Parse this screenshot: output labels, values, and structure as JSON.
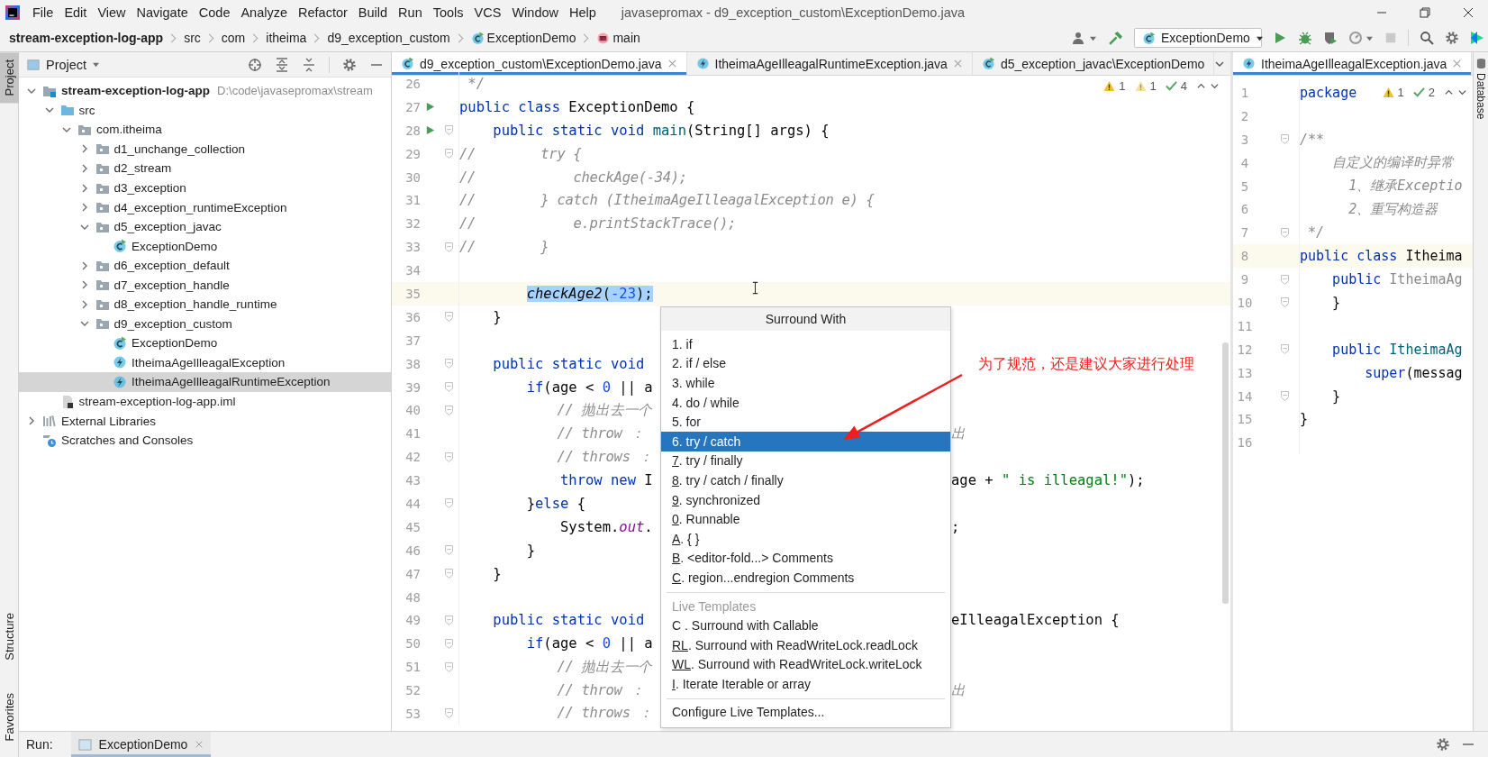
{
  "title_bar": {
    "menu": [
      "File",
      "Edit",
      "View",
      "Navigate",
      "Code",
      "Analyze",
      "Refactor",
      "Build",
      "Run",
      "Tools",
      "VCS",
      "Window",
      "Help"
    ],
    "title": "javasepromax - d9_exception_custom\\ExceptionDemo.java"
  },
  "breadcrumbs": [
    {
      "text": "stream-exception-log-app",
      "kind": "project"
    },
    {
      "text": "src",
      "kind": "folder"
    },
    {
      "text": "com",
      "kind": "folder"
    },
    {
      "text": "itheima",
      "kind": "folder"
    },
    {
      "text": "d9_exception_custom",
      "kind": "folder"
    },
    {
      "text": "ExceptionDemo",
      "kind": "class"
    },
    {
      "text": "main",
      "kind": "method"
    }
  ],
  "run_configuration": "ExceptionDemo",
  "left_strip": {
    "top": [
      {
        "label": "Project",
        "selected": true
      }
    ],
    "bottom": [
      {
        "label": "Structure",
        "selected": false
      },
      {
        "label": "Favorites",
        "selected": false
      }
    ]
  },
  "project_panel": {
    "title": "Project",
    "tree": [
      {
        "name": "stream-exception-log-app",
        "kind": "module",
        "path": "D:\\code\\javasepromax\\stream",
        "expanded": true,
        "selected": false,
        "children": [
          {
            "name": "src",
            "kind": "source-folder",
            "expanded": true,
            "selected": false,
            "children": [
              {
                "name": "com.itheima",
                "kind": "package",
                "expanded": true,
                "selected": false,
                "children": [
                  {
                    "name": "d1_unchange_collection",
                    "kind": "package",
                    "expanded": false,
                    "selected": false
                  },
                  {
                    "name": "d2_stream",
                    "kind": "package",
                    "expanded": false,
                    "selected": false
                  },
                  {
                    "name": "d3_exception",
                    "kind": "package",
                    "expanded": false,
                    "selected": false
                  },
                  {
                    "name": "d4_exception_runtimeException",
                    "kind": "package",
                    "expanded": false,
                    "selected": false
                  },
                  {
                    "name": "d5_exception_javac",
                    "kind": "package",
                    "expanded": true,
                    "selected": false,
                    "children": [
                      {
                        "name": "ExceptionDemo",
                        "kind": "class",
                        "selected": false
                      }
                    ]
                  },
                  {
                    "name": "d6_exception_default",
                    "kind": "package",
                    "expanded": false,
                    "selected": false
                  },
                  {
                    "name": "d7_exception_handle",
                    "kind": "package",
                    "expanded": false,
                    "selected": false
                  },
                  {
                    "name": "d8_exception_handle_runtime",
                    "kind": "package",
                    "expanded": false,
                    "selected": false
                  },
                  {
                    "name": "d9_exception_custom",
                    "kind": "package",
                    "expanded": true,
                    "selected": false,
                    "children": [
                      {
                        "name": "ExceptionDemo",
                        "kind": "class",
                        "selected": false
                      },
                      {
                        "name": "ItheimaAgeIlleagalException",
                        "kind": "exception",
                        "selected": false
                      },
                      {
                        "name": "ItheimaAgeIlleagalRuntimeException",
                        "kind": "exception",
                        "selected": true
                      }
                    ]
                  }
                ]
              }
            ]
          },
          {
            "name": "stream-exception-log-app.iml",
            "kind": "iml",
            "selected": false
          }
        ]
      },
      {
        "name": "External Libraries",
        "kind": "libraries",
        "expanded": false,
        "selected": false
      },
      {
        "name": "Scratches and Consoles",
        "kind": "scratches",
        "selected": false
      }
    ]
  },
  "editors": [
    {
      "tabs": [
        {
          "title": "d9_exception_custom\\ExceptionDemo.java",
          "kind": "class",
          "selected": true,
          "closable": true
        },
        {
          "title": "ItheimaAgeIlleagalRuntimeException.java",
          "kind": "exception",
          "selected": false,
          "closable": true
        },
        {
          "title": "d5_exception_javac\\ExceptionDemo",
          "kind": "class",
          "selected": false,
          "closable": false
        }
      ],
      "inspections": [
        {
          "kind": "warning",
          "count": "1"
        },
        {
          "kind": "weak-warning",
          "count": "1"
        },
        {
          "kind": "ok",
          "count": "4"
        }
      ],
      "lines": [
        {
          "number": "26",
          "current": false,
          "code": [
            {
              "text": " */",
              "kind": "doc"
            }
          ]
        },
        {
          "number": "27",
          "current": false,
          "run": true,
          "code": [
            {
              "text": "public class ",
              "kind": "keyword"
            },
            {
              "text": "ExceptionDemo {",
              "kind": "plain"
            }
          ]
        },
        {
          "number": "28",
          "current": false,
          "run": true,
          "fold": true,
          "code": [
            {
              "text": "    public static void ",
              "kind": "keyword"
            },
            {
              "text": "main",
              "kind": "method-decl"
            },
            {
              "text": "(String[] args) {",
              "kind": "plain"
            }
          ]
        },
        {
          "number": "29",
          "current": false,
          "fold": true,
          "code": [
            {
              "text": "//        try {",
              "kind": "comment"
            }
          ]
        },
        {
          "number": "30",
          "current": false,
          "code": [
            {
              "text": "//            checkAge(-34);",
              "kind": "comment"
            }
          ]
        },
        {
          "number": "31",
          "current": false,
          "code": [
            {
              "text": "//        } catch (ItheimaAgeIlleagalException e) {",
              "kind": "comment"
            }
          ]
        },
        {
          "number": "32",
          "current": false,
          "code": [
            {
              "text": "//            e.printStackTrace();",
              "kind": "comment"
            }
          ]
        },
        {
          "number": "33",
          "current": false,
          "fold": true,
          "code": [
            {
              "text": "//        }",
              "kind": "comment"
            }
          ]
        },
        {
          "number": "34",
          "current": false
        },
        {
          "number": "35",
          "current": true,
          "code": [
            {
              "text": "        checkAge2",
              "kind": "static-call",
              "selected": true
            },
            {
              "text": "(",
              "kind": "plain",
              "selected": true
            },
            {
              "text": "-23",
              "kind": "number",
              "selected": true
            },
            {
              "text": ");",
              "kind": "plain",
              "selected": true
            }
          ]
        },
        {
          "number": "36",
          "current": false,
          "fold": true,
          "code": [
            {
              "text": "    }",
              "kind": "plain"
            }
          ]
        },
        {
          "number": "37",
          "current": false
        },
        {
          "number": "38",
          "current": false,
          "fold": true,
          "code": [
            {
              "text": "    public static void ",
              "kind": "keyword"
            }
          ]
        },
        {
          "number": "39",
          "current": false,
          "fold": true,
          "code": [
            {
              "text": "        if",
              "kind": "keyword"
            },
            {
              "text": "(age < ",
              "kind": "plain"
            },
            {
              "text": "0",
              "kind": "number"
            },
            {
              "text": " || a",
              "kind": "plain"
            }
          ]
        },
        {
          "number": "40",
          "current": false,
          "fold": true,
          "code": [
            {
              "text": "            // 抛出去一个",
              "kind": "comment"
            }
          ]
        },
        {
          "number": "41",
          "current": false,
          "code": [
            {
              "text": "            // throw ：",
              "kind": "comment"
            }
          ],
          "right": [
            {
              "text": "出",
              "kind": "comment"
            }
          ]
        },
        {
          "number": "42",
          "current": false,
          "fold": true,
          "code": [
            {
              "text": "            // throws ：",
              "kind": "comment"
            }
          ]
        },
        {
          "number": "43",
          "current": false,
          "code": [
            {
              "text": "            throw new ",
              "kind": "keyword"
            },
            {
              "text": "I",
              "kind": "plain"
            }
          ],
          "right": [
            {
              "text": "age + ",
              "kind": "plain"
            },
            {
              "text": "\" is illeagal!\"",
              "kind": "string"
            },
            {
              "text": ");",
              "kind": "plain"
            }
          ]
        },
        {
          "number": "44",
          "current": false,
          "fold": true,
          "code": [
            {
              "text": "        }",
              "kind": "plain"
            },
            {
              "text": "else",
              "kind": "keyword"
            },
            {
              "text": " {",
              "kind": "plain"
            }
          ]
        },
        {
          "number": "45",
          "current": false,
          "code": [
            {
              "text": "            System.",
              "kind": "plain"
            },
            {
              "text": "out",
              "kind": "static-field"
            },
            {
              "text": ".",
              "kind": "plain"
            }
          ],
          "right": [
            {
              "text": ";",
              "kind": "plain"
            }
          ]
        },
        {
          "number": "46",
          "current": false,
          "fold": true,
          "code": [
            {
              "text": "        }",
              "kind": "plain"
            }
          ]
        },
        {
          "number": "47",
          "current": false,
          "fold": true,
          "code": [
            {
              "text": "    }",
              "kind": "plain"
            }
          ]
        },
        {
          "number": "48",
          "current": false
        },
        {
          "number": "49",
          "current": false,
          "fold": true,
          "code": [
            {
              "text": "    public static void ",
              "kind": "keyword"
            }
          ],
          "right": [
            {
              "text": "eIlleagalException {",
              "kind": "plain"
            }
          ]
        },
        {
          "number": "50",
          "current": false,
          "fold": true,
          "code": [
            {
              "text": "        if",
              "kind": "keyword"
            },
            {
              "text": "(age < ",
              "kind": "plain"
            },
            {
              "text": "0",
              "kind": "number"
            },
            {
              "text": " || a",
              "kind": "plain"
            }
          ]
        },
        {
          "number": "51",
          "current": false,
          "fold": true,
          "code": [
            {
              "text": "            // 抛出去一个",
              "kind": "comment"
            }
          ]
        },
        {
          "number": "52",
          "current": false,
          "code": [
            {
              "text": "            // throw ：",
              "kind": "comment"
            }
          ],
          "right": [
            {
              "text": "出",
              "kind": "comment"
            }
          ]
        },
        {
          "number": "53",
          "current": false,
          "fold": true,
          "code": [
            {
              "text": "            // throws ：",
              "kind": "comment"
            }
          ]
        }
      ]
    },
    {
      "tabs": [
        {
          "title": "ItheimaAgeIlleagalException.java",
          "kind": "exception",
          "selected": true,
          "closable": true
        }
      ],
      "inspections": [
        {
          "kind": "warning",
          "count": "1"
        },
        {
          "kind": "ok",
          "count": "2"
        }
      ],
      "lines": [
        {
          "number": "1",
          "current": false,
          "code": [
            {
              "text": "package",
              "kind": "keyword"
            }
          ]
        },
        {
          "number": "2",
          "current": false
        },
        {
          "number": "3",
          "current": false,
          "fold": true,
          "code": [
            {
              "text": "/**",
              "kind": "doc"
            }
          ]
        },
        {
          "number": "4",
          "current": false,
          "code": [
            {
              "text": "    自定义的编译时异常",
              "kind": "doc"
            }
          ]
        },
        {
          "number": "5",
          "current": false,
          "code": [
            {
              "text": "      1、继承Exceptio",
              "kind": "doc"
            }
          ]
        },
        {
          "number": "6",
          "current": false,
          "code": [
            {
              "text": "      2、重写构造器",
              "kind": "doc"
            }
          ]
        },
        {
          "number": "7",
          "current": false,
          "fold": true,
          "code": [
            {
              "text": " */",
              "kind": "doc"
            }
          ]
        },
        {
          "number": "8",
          "current": true,
          "code": [
            {
              "text": "public class ",
              "kind": "keyword"
            },
            {
              "text": "Itheima",
              "kind": "plain"
            }
          ]
        },
        {
          "number": "9",
          "current": false,
          "fold": true,
          "code": [
            {
              "text": "    public ",
              "kind": "keyword"
            },
            {
              "text": "ItheimaAg",
              "kind": "unused"
            }
          ]
        },
        {
          "number": "10",
          "current": false,
          "fold": true,
          "code": [
            {
              "text": "    }",
              "kind": "plain"
            }
          ]
        },
        {
          "number": "11",
          "current": false
        },
        {
          "number": "12",
          "current": false,
          "fold": true,
          "code": [
            {
              "text": "    public ",
              "kind": "keyword"
            },
            {
              "text": "ItheimaAg",
              "kind": "method-decl"
            }
          ]
        },
        {
          "number": "13",
          "current": false,
          "code": [
            {
              "text": "        super",
              "kind": "keyword"
            },
            {
              "text": "(messag",
              "kind": "plain"
            }
          ]
        },
        {
          "number": "14",
          "current": false,
          "fold": true,
          "code": [
            {
              "text": "    }",
              "kind": "plain"
            }
          ]
        },
        {
          "number": "15",
          "current": false,
          "code": [
            {
              "text": "}",
              "kind": "plain"
            }
          ]
        },
        {
          "number": "16",
          "current": false
        }
      ]
    }
  ],
  "right_strip": {
    "label": "Database"
  },
  "popup": {
    "title": "Surround With",
    "sections": [
      {
        "items": [
          {
            "key": "1",
            "label": ". if",
            "underlined": false,
            "selected": false
          },
          {
            "key": "2",
            "label": ". if / else",
            "underlined": false,
            "selected": false
          },
          {
            "key": "3",
            "label": ". while",
            "underlined": false,
            "selected": false
          },
          {
            "key": "4",
            "label": ". do / while",
            "underlined": false,
            "selected": false
          },
          {
            "key": "5",
            "label": ". for",
            "underlined": false,
            "selected": false
          },
          {
            "key": "6",
            "label": ". try / catch",
            "underlined": false,
            "selected": true
          },
          {
            "key": "7",
            "label": ". try / finally",
            "underlined": true,
            "selected": false
          },
          {
            "key": "8",
            "label": ". try / catch / finally",
            "underlined": true,
            "selected": false
          },
          {
            "key": "9",
            "label": ". synchronized",
            "underlined": true,
            "selected": false
          },
          {
            "key": "0",
            "label": ". Runnable",
            "underlined": true,
            "selected": false
          },
          {
            "key": "A",
            "label": ". { }",
            "underlined": true,
            "selected": false
          },
          {
            "key": "B",
            "label": ". <editor-fold...> Comments",
            "underlined": true,
            "selected": false
          },
          {
            "key": "C",
            "label": ". region...endregion Comments",
            "underlined": true,
            "selected": false
          }
        ]
      },
      {
        "heading": "Live Templates",
        "items": [
          {
            "key": "C",
            "label": " . Surround with Callable",
            "underlined": false,
            "selected": false
          },
          {
            "key": "RL",
            "label": ". Surround with ReadWriteLock.readLock",
            "underlined": true,
            "selected": false
          },
          {
            "key": "WL",
            "label": ". Surround with ReadWriteLock.writeLock",
            "underlined": true,
            "selected": false
          },
          {
            "key": "I",
            "label": ". Iterate Iterable or array",
            "underlined": true,
            "selected": false
          }
        ]
      },
      {
        "items": [
          {
            "label": "Configure Live Templates...",
            "selected": false
          }
        ]
      }
    ]
  },
  "annotation": {
    "text": "为了规范，还是建议大家进行处理"
  },
  "run_bar": {
    "label": "Run:",
    "tabs": [
      {
        "title": "ExceptionDemo",
        "selected": true,
        "closable": true
      }
    ]
  }
}
